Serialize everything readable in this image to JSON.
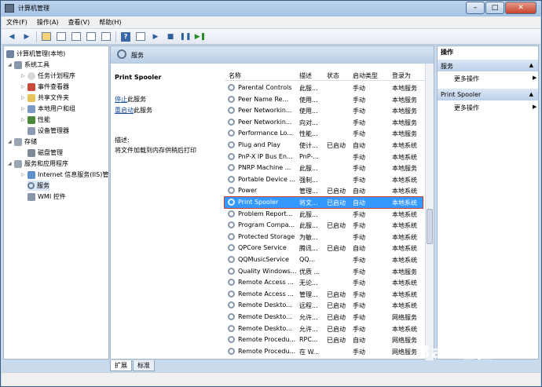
{
  "window": {
    "title": "计算机管理"
  },
  "window_controls": {
    "minimize": "–",
    "maximize": "□",
    "close": "✕"
  },
  "menu": [
    "文件(F)",
    "操作(A)",
    "查看(V)",
    "帮助(H)"
  ],
  "tree": {
    "root": "计算机管理(本地)",
    "items": [
      {
        "label": "系统工具",
        "level": 1
      },
      {
        "label": "任务计划程序",
        "level": 2
      },
      {
        "label": "事件查看器",
        "level": 2
      },
      {
        "label": "共享文件夹",
        "level": 2
      },
      {
        "label": "本地用户和组",
        "level": 2
      },
      {
        "label": "性能",
        "level": 2
      },
      {
        "label": "设备管理器",
        "level": 2
      },
      {
        "label": "存储",
        "level": 1
      },
      {
        "label": "磁盘管理",
        "level": 2
      },
      {
        "label": "服务和应用程序",
        "level": 1
      },
      {
        "label": "Internet 信息服务(IIS)管",
        "level": 2
      },
      {
        "label": "服务",
        "level": 2
      },
      {
        "label": "WMI 控件",
        "level": 2
      }
    ]
  },
  "main": {
    "header": "服务",
    "detail": {
      "title": "Print Spooler",
      "stop_link": "停止",
      "stop_suffix": "此服务",
      "restart_link": "重启动",
      "restart_suffix": "此服务",
      "desc_label": "描述:",
      "desc_text": "将文件加载到内存供稍后打印"
    },
    "columns": [
      "名称",
      "描述",
      "状态",
      "启动类型",
      "登录为"
    ],
    "rows": [
      [
        "Parental Controls",
        "此服...",
        "",
        "手动",
        "本地服务"
      ],
      [
        "Peer Name Re...",
        "使用...",
        "",
        "手动",
        "本地服务"
      ],
      [
        "Peer Networkin...",
        "使用...",
        "",
        "手动",
        "本地服务"
      ],
      [
        "Peer Networkin...",
        "向对...",
        "",
        "手动",
        "本地服务"
      ],
      [
        "Performance Lo...",
        "性能...",
        "",
        "手动",
        "本地服务"
      ],
      [
        "Plug and Play",
        "使计...",
        "已启动",
        "自动",
        "本地系统"
      ],
      [
        "PnP-X IP Bus En...",
        "PnP-...",
        "",
        "手动",
        "本地系统"
      ],
      [
        "PNRP Machine ...",
        "此服...",
        "",
        "手动",
        "本地服务"
      ],
      [
        "Portable Device ...",
        "强制...",
        "",
        "手动",
        "本地系统"
      ],
      [
        "Power",
        "管理...",
        "已启动",
        "自动",
        "本地系统"
      ],
      [
        "Print Spooler",
        "将文...",
        "已启动",
        "自动",
        "本地系统"
      ],
      [
        "Problem Report...",
        "此服...",
        "",
        "手动",
        "本地系统"
      ],
      [
        "Program Compa...",
        "此服...",
        "已启动",
        "手动",
        "本地系统"
      ],
      [
        "Protected Storage",
        "为敏...",
        "",
        "手动",
        "本地系统"
      ],
      [
        "QPCore Service",
        "腾讯...",
        "已启动",
        "自动",
        "本地系统"
      ],
      [
        "QQMusicService",
        "QQ...",
        "",
        "手动",
        "本地系统"
      ],
      [
        "Quality Windows...",
        "优质 ...",
        "",
        "手动",
        "本地服务"
      ],
      [
        "Remote Access ...",
        "无论...",
        "",
        "手动",
        "本地系统"
      ],
      [
        "Remote Access ...",
        "管理...",
        "已启动",
        "手动",
        "本地系统"
      ],
      [
        "Remote Deskto...",
        "远程...",
        "已启动",
        "手动",
        "本地系统"
      ],
      [
        "Remote Deskto...",
        "允许...",
        "已启动",
        "手动",
        "网络服务"
      ],
      [
        "Remote Deskto...",
        "允许...",
        "已启动",
        "手动",
        "本地系统"
      ],
      [
        "Remote Procedu...",
        "RPC...",
        "已启动",
        "自动",
        "网络服务"
      ],
      [
        "Remote Procedu...",
        "在 W...",
        "",
        "手动",
        "网络服务"
      ]
    ],
    "selected_row": 10,
    "tabs": [
      "扩展",
      "标准"
    ]
  },
  "actions": {
    "title": "操作",
    "sections": [
      {
        "label": "服务",
        "item": "更多操作"
      },
      {
        "label": "Print Spooler",
        "item": "更多操作"
      }
    ]
  },
  "watermark": "Bai 经验"
}
